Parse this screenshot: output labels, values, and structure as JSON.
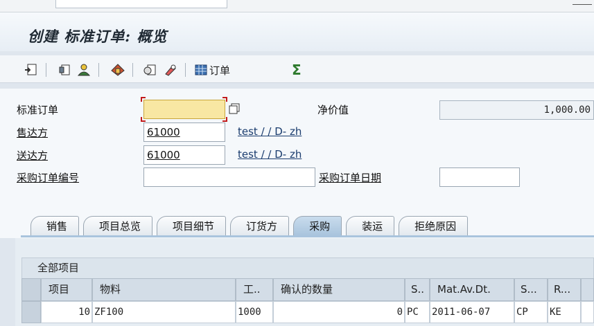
{
  "window": {
    "title": "创建 标准订单: 概览"
  },
  "toolbar": {
    "order_label": "订单"
  },
  "header": {
    "std_order_label": "标准订单",
    "std_order_value": "",
    "sold_to_label": "售达方",
    "sold_to_value": "61000",
    "sold_to_desc": "test / / D- zh",
    "ship_to_label": "送达方",
    "ship_to_value": "61000",
    "ship_to_desc": "test / / D- zh",
    "po_number_label": "采购订单编号",
    "po_number_value": "",
    "net_value_label": "净价值",
    "net_value": "1,000.00",
    "po_date_label": "采购订单日期",
    "po_date_value": ""
  },
  "tabs": [
    {
      "label": "销售"
    },
    {
      "label": "项目总览"
    },
    {
      "label": "项目细节"
    },
    {
      "label": "订货方"
    },
    {
      "label": "采购"
    },
    {
      "label": "装运"
    },
    {
      "label": "拒绝原因"
    }
  ],
  "active_tab": "采购",
  "items_table": {
    "title": "全部项目",
    "columns": [
      "项目",
      "物料",
      "工..",
      "确认的数量",
      "S..",
      "Mat.Av.Dt.",
      "S...",
      "R..."
    ],
    "rows": [
      {
        "item": "10",
        "material": "ZF100",
        "plant": "1000",
        "confirmed_qty": "0",
        "unit": "PC",
        "mat_av_dt": "2011-06-07",
        "shipping": "CP",
        "route": "KE"
      }
    ]
  },
  "colors": {
    "accent_tab": "#a9c4dd",
    "required_field": "#f8e7a3"
  }
}
